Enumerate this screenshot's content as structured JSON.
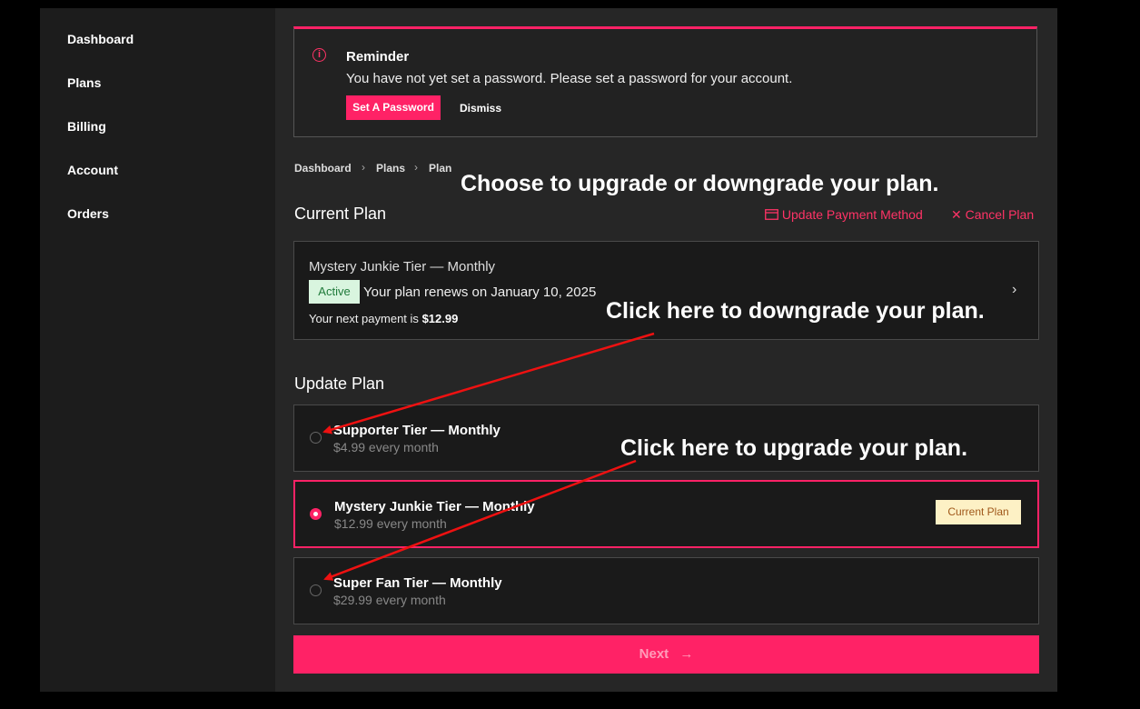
{
  "sidebar": {
    "items": [
      {
        "label": "Dashboard"
      },
      {
        "label": "Plans"
      },
      {
        "label": "Billing"
      },
      {
        "label": "Account"
      },
      {
        "label": "Orders"
      }
    ]
  },
  "reminder": {
    "title": "Reminder",
    "text": "You have not yet set a password. Please set a password for your account.",
    "set_password_label": "Set A Password",
    "dismiss_label": "Dismiss",
    "icon": "info-icon"
  },
  "breadcrumb": {
    "items": [
      "Dashboard",
      "Plans",
      "Plan"
    ],
    "separator": "›"
  },
  "current_plan": {
    "heading": "Current Plan",
    "update_payment_label": "Update Payment Method",
    "cancel_label": "Cancel Plan",
    "card": {
      "title": "Mystery Junkie Tier — Monthly",
      "status": "Active",
      "renew_text": "Your plan renews on January 10, 2025",
      "payment_prefix": "Your next payment is",
      "payment_amount": "$12.99",
      "chevron": "›"
    }
  },
  "update_plan": {
    "heading": "Update Plan",
    "plans": [
      {
        "name": "Supporter Tier — Monthly",
        "price": "$4.99 every month",
        "selected": false
      },
      {
        "name": "Mystery Junkie Tier — Monthly",
        "price": "$12.99 every month",
        "selected": true,
        "badge": "Current Plan"
      },
      {
        "name": "Super Fan Tier — Monthly",
        "price": "$29.99 every month",
        "selected": false
      }
    ]
  },
  "next_button": {
    "label": "Next",
    "arrow": "→"
  },
  "annotations": {
    "top": "Choose to upgrade or downgrade your plan.",
    "downgrade": "Click here to downgrade your plan.",
    "upgrade": "Click here to upgrade your plan."
  },
  "colors": {
    "accent": "#ff2266",
    "background": "#262626",
    "sidebar": "#1c1c1c",
    "active_badge": "#d9f5df",
    "current_badge": "#fdf1c5",
    "arrow": "#ee1111"
  }
}
